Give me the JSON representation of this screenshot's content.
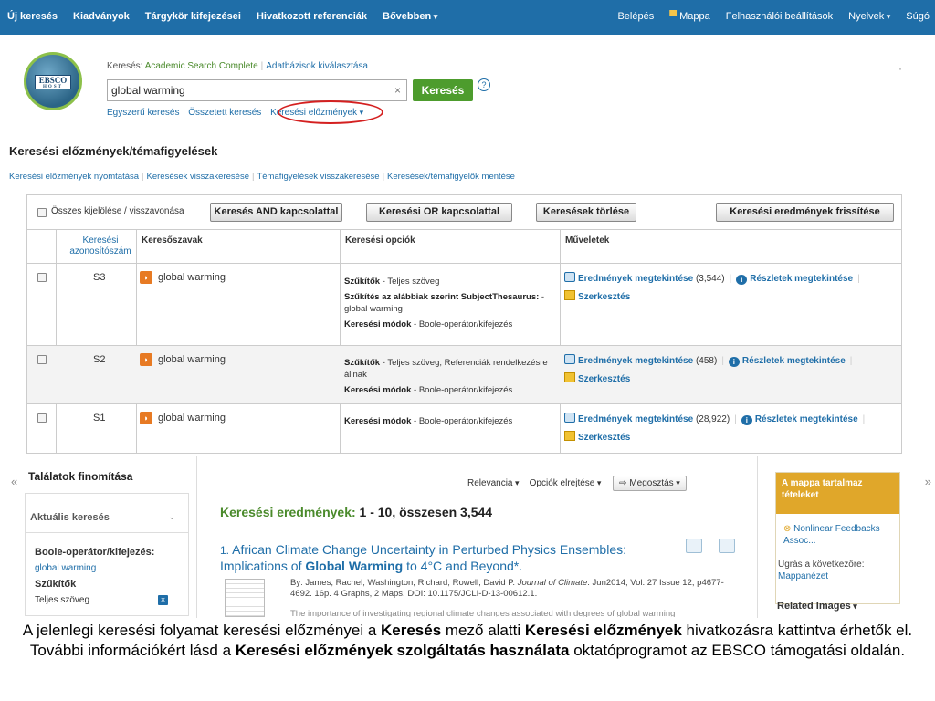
{
  "nav": {
    "left": [
      "Új keresés",
      "Kiadványok",
      "Tárgykör kifejezései",
      "Hivatkozott referenciák",
      "Bővebben"
    ],
    "right": [
      "Belépés",
      "Mappa",
      "Felhasználói beállítások",
      "Nyelvek",
      "Súgó"
    ]
  },
  "header": {
    "db_prefix": "Keresés:",
    "db_name": "Academic Search Complete",
    "db_choose": "Adatbázisok kiválasztása",
    "search_value": "global warming",
    "search_button": "Keresés",
    "help": "?",
    "links": [
      "Egyszerű keresés",
      "Összetett keresés",
      "Keresési előzmények"
    ]
  },
  "history": {
    "title": "Keresési előzmények/témafigyelések",
    "links": [
      "Keresési előzmények nyomtatása",
      "Keresések visszakeresése",
      "Témafigyelések visszakeresése",
      "Keresések/témafigyelők mentése"
    ],
    "select_all": "Összes kijelölése / visszavonása",
    "buttons": {
      "and": "Keresés AND kapcsolattal",
      "or": "Keresési OR kapcsolattal",
      "delete": "Keresések törlése",
      "refresh": "Keresési eredmények frissítése"
    },
    "columns": [
      "Keresési azonosítószám",
      "Keresőszavak",
      "Keresési opciók",
      "Műveletek"
    ],
    "rows": [
      {
        "id": "S3",
        "terms": "global warming",
        "opt1_b": "Szűkítők",
        "opt1": " - Teljes szöveg",
        "opt2_b": "Szűkítés az alábbiak szerint SubjectThesaurus:",
        "opt2": " - global warming",
        "opt3_b": "Keresési módok",
        "opt3": " - Boole-operátor/kifejezés",
        "view": "Eredmények megtekintése",
        "count": "(3,544)",
        "details": "Részletek megtekintése",
        "edit": "Szerkesztés"
      },
      {
        "id": "S2",
        "terms": "global warming",
        "opt1_b": "Szűkítők",
        "opt1": " - Teljes szöveg; Referenciák rendelkezésre állnak",
        "opt3_b": "Keresési módok",
        "opt3": " - Boole-operátor/kifejezés",
        "view": "Eredmények megtekintése",
        "count": "(458)",
        "details": "Részletek megtekintése",
        "edit": "Szerkesztés"
      },
      {
        "id": "S1",
        "terms": "global warming",
        "opt3_b": "Keresési módok",
        "opt3": " - Boole-operátor/kifejezés",
        "view": "Eredmények megtekintése",
        "count": "(28,922)",
        "details": "Részletek megtekintése",
        "edit": "Szerkesztés"
      }
    ]
  },
  "refine": {
    "title": "Találatok finomítása",
    "current": "Aktuális keresés",
    "boolean_label": "Boole-operátor/kifejezés:",
    "boolean_value": "global warming",
    "limiters": "Szűkítők",
    "fulltext": "Teljes szöveg"
  },
  "results": {
    "sort": "Relevancia",
    "options": "Opciók elrejtése",
    "share": "Megosztás",
    "heading": "Keresési eredmények:",
    "range": "1 - 10, összesen 3,544",
    "item_num": "1.",
    "item_title_a": "African Climate Change Uncertainty in Perturbed Physics Ensembles: Implications of ",
    "item_title_b": "Global Warming",
    "item_title_c": " to 4°C and Beyond*.",
    "item_meta_a": "By: James, Rachel; Washington, Richard; Rowell, David P. ",
    "item_meta_journal": "Journal of Climate",
    "item_meta_b": ". Jun2014, Vol. 27 Issue 12, p4677-4692. 16p. 4 Graphs, 2 Maps. DOI: 10.1175/JCLI-D-13-00612.1.",
    "item_abstract": "The importance of investigating regional climate changes associated with degrees of global warming"
  },
  "folder": {
    "title": "A mappa tartalmaz tételeket",
    "item": "Nonlinear Feedbacks Assoc...",
    "goto": "Ugrás a következőre:",
    "goto_link": "Mappanézet",
    "related": "Related Images"
  },
  "caption": {
    "p1": "A jelenlegi keresési folyamat keresési előzményei a ",
    "b1": "Keresés",
    "p2": " mező alatti ",
    "b2": "Keresési előzmények",
    "p3": " hivatkozásra kattintva érhetők el. További információkért lásd a ",
    "b3": "Keresési előzmények szolgáltatás használata",
    "p4": " oktatóprogramot az EBSCO támogatási oldalán."
  },
  "colors": {
    "nav": "#1f6ea8",
    "accent_green": "#4d9c2d",
    "folder": "#e0a72a",
    "highlight_circle": "#d42020"
  }
}
